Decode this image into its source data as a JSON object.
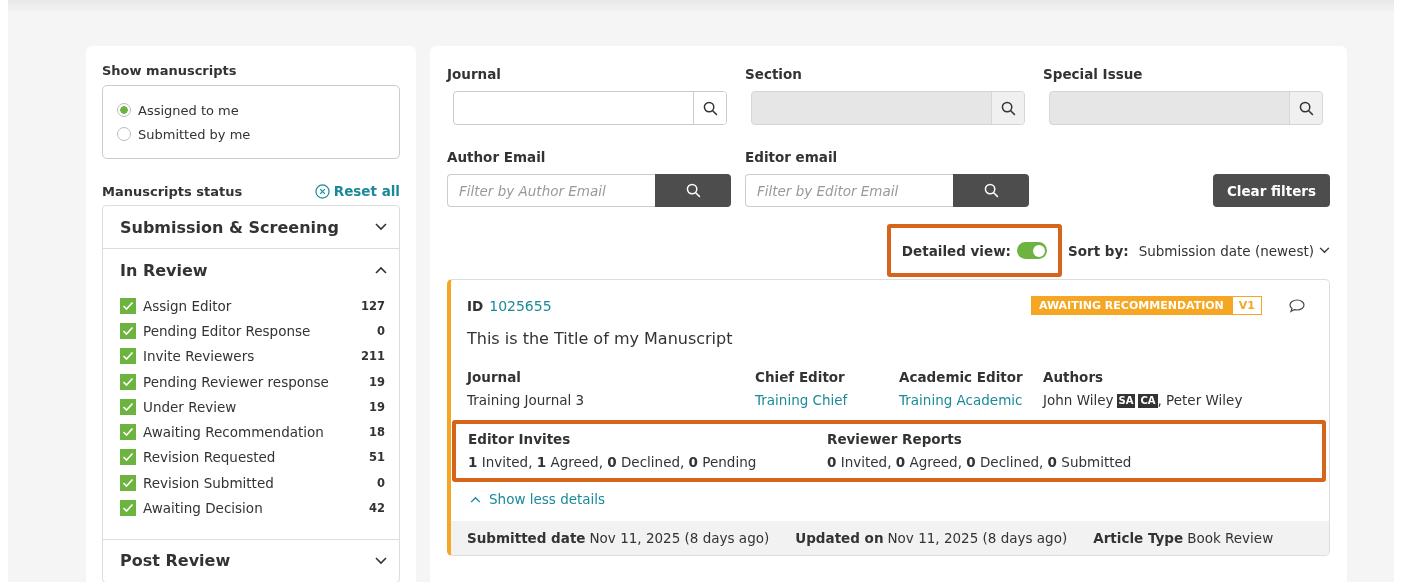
{
  "sidebar": {
    "show_title": "Show manuscripts",
    "show_options": [
      {
        "label": "Assigned to me",
        "selected": true
      },
      {
        "label": "Submitted by me",
        "selected": false
      }
    ],
    "status_title": "Manuscripts status",
    "reset": "Reset all",
    "groups": [
      {
        "title": "Submission & Screening",
        "expanded": false
      },
      {
        "title": "In Review",
        "expanded": true,
        "items": [
          {
            "label": "Assign Editor",
            "count": "127",
            "checked": true
          },
          {
            "label": "Pending Editor Response",
            "count": "0",
            "checked": true
          },
          {
            "label": "Invite Reviewers",
            "count": "211",
            "checked": true
          },
          {
            "label": "Pending Reviewer response",
            "count": "19",
            "checked": true
          },
          {
            "label": "Under Review",
            "count": "19",
            "checked": true
          },
          {
            "label": "Awaiting Recommendation",
            "count": "18",
            "checked": true
          },
          {
            "label": "Revision Requested",
            "count": "51",
            "checked": true
          },
          {
            "label": "Revision Submitted",
            "count": "0",
            "checked": true
          },
          {
            "label": "Awaiting Decision",
            "count": "42",
            "checked": true
          }
        ]
      },
      {
        "title": "Post Review",
        "expanded": false
      }
    ]
  },
  "filters": {
    "top": [
      {
        "label": "Journal",
        "disabled": false
      },
      {
        "label": "Section",
        "disabled": true
      },
      {
        "label": "Special Issue",
        "disabled": true
      }
    ],
    "emails": [
      {
        "label": "Author Email",
        "placeholder": "Filter by Author Email"
      },
      {
        "label": "Editor email",
        "placeholder": "Filter by Editor Email"
      }
    ],
    "clear": "Clear filters"
  },
  "view": {
    "detailed_label": "Detailed view:",
    "detailed_on": true,
    "highlighted": true,
    "sort_label": "Sort by:",
    "sort_value": "Submission date (newest)"
  },
  "manuscript": {
    "id_label": "ID",
    "id": "1025655",
    "status": "AWAITING RECOMMENDATION",
    "version": "V1",
    "title": "This is the Title of my Manuscript",
    "fields": [
      {
        "label": "Journal",
        "value": "Training Journal 3",
        "kind": "text"
      },
      {
        "label": "Chief Editor",
        "value": "Training Chief",
        "kind": "link"
      },
      {
        "label": "Academic Editor",
        "value": "Training Academic",
        "kind": "link"
      }
    ],
    "authors_label": "Authors",
    "authors": [
      {
        "name": "John Wiley",
        "roles": [
          "SA",
          "CA"
        ]
      },
      {
        "name": ", Peter Wiley"
      }
    ],
    "stats_highlighted": true,
    "stats": [
      {
        "label": "Editor Invites",
        "value": "**1** Invited, **1** Agreed, **0** Declined, **0** Pending"
      },
      {
        "label": "Reviewer Reports",
        "value": "**0** Invited, **0** Agreed, **0** Declined, **0** Submitted"
      }
    ],
    "toggle_details": "Show less details",
    "footer": [
      {
        "label": "Submitted date",
        "value": "Nov 11, 2025 (8 days ago)"
      },
      {
        "label": "Updated on",
        "value": "Nov 11, 2025 (8 days ago)"
      },
      {
        "label": "Article Type",
        "value": "Book Review"
      }
    ]
  }
}
